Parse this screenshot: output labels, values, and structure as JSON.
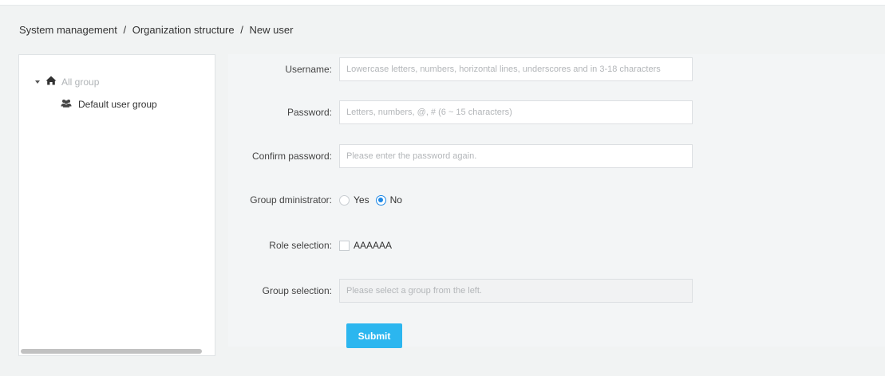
{
  "breadcrumb": {
    "items": [
      "System management",
      "Organization structure",
      "New user"
    ],
    "separator": "/"
  },
  "tree": {
    "root": {
      "label": "All group",
      "icon": "home-icon",
      "expanded": true
    },
    "children": [
      {
        "label": "Default user group",
        "icon": "users-icon"
      }
    ]
  },
  "form": {
    "username": {
      "label": "Username:",
      "value": "",
      "placeholder": "Lowercase letters, numbers, horizontal lines, underscores and in 3-18 characters"
    },
    "password": {
      "label": "Password:",
      "value": "",
      "placeholder": "Letters, numbers, @, # (6 ~ 15 characters)"
    },
    "confirm_password": {
      "label": "Confirm password:",
      "value": "",
      "placeholder": "Please enter the password again."
    },
    "group_admin": {
      "label": "Group dministrator:",
      "options": [
        {
          "label": "Yes",
          "checked": false
        },
        {
          "label": "No",
          "checked": true
        }
      ]
    },
    "role": {
      "label": "Role selection:",
      "options": [
        {
          "label": "AAAAAA",
          "checked": false
        }
      ]
    },
    "group": {
      "label": "Group selection:",
      "value": "",
      "placeholder": "Please select a group from the left.",
      "disabled": true
    },
    "submit_label": "Submit"
  },
  "colors": {
    "accent": "#1e88e5",
    "submit": "#2cb6ef",
    "background": "#f1f3f3"
  }
}
